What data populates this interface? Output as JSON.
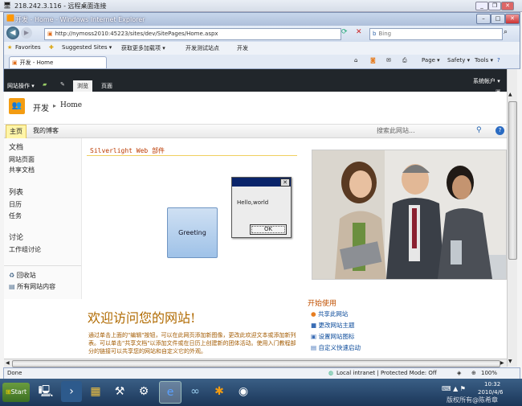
{
  "rdp": {
    "title": "218.242.3.116 - 远程桌面连接"
  },
  "ie": {
    "window_title": "开发 - Home - Windows Internet Explorer",
    "address": "http://nymoss2010:45223/sites/dev/SitePages/Home.aspx",
    "search_placeholder": "Bing",
    "favorites_label": "Favorites",
    "fav_items": [
      "Suggested Sites ▾",
      "获取更多加载项 ▾",
      "开发测试站点",
      "开发"
    ],
    "tab_label": "开发 - Home",
    "cmd_items": [
      "Page ▾",
      "Safety ▾",
      "Tools ▾"
    ]
  },
  "ribbon": {
    "site_actions": "网站操作 ▾",
    "tabs": [
      "浏览",
      "页面"
    ],
    "user": "系统帐户 ▾"
  },
  "sp": {
    "site_title": "开发",
    "breadcrumb_sep": "▸",
    "breadcrumb_page": "Home",
    "topnav": [
      "主页",
      "我的博客"
    ],
    "search_placeholder": "搜索此网站...",
    "webpart_title": "Silverlight Web 部件",
    "welcome": "欢迎访问您的网站!",
    "body_text": "通过单击上面的\"编辑\"按钮，可以在此网页添加新图像，更改此欢迎文本或添加新列表。可以单击\"共享文档\"以添加文件或在日历上创建新的团体活动。使用入门教程部分的链接可以共享您的网站和自定义它的外观。",
    "getting_started_title": "开始使用",
    "getting_started": [
      "共享此网站",
      "更改网站主题",
      "设置网站图标",
      "自定义快速启动"
    ]
  },
  "leftnav": {
    "docs_heading": "文档",
    "docs": [
      "网站页面",
      "共享文档"
    ],
    "lists_heading": "列表",
    "lists": [
      "日历",
      "任务"
    ],
    "disc_heading": "讨论",
    "disc": [
      "工作组讨论"
    ],
    "recycle": "回收站",
    "all_content": "所有网站内容"
  },
  "silverlight": {
    "button_label": "Greeting",
    "dialog_text": "Hello,world",
    "ok_label": "OK"
  },
  "statusbar": {
    "left": "Done",
    "zone": "Local intranet | Protected Mode: Off",
    "zoom": "100%"
  },
  "taskbar": {
    "start": "Start",
    "time": "10:32",
    "date": "2010/4/6",
    "watermark": "版权所有@陈希章"
  }
}
